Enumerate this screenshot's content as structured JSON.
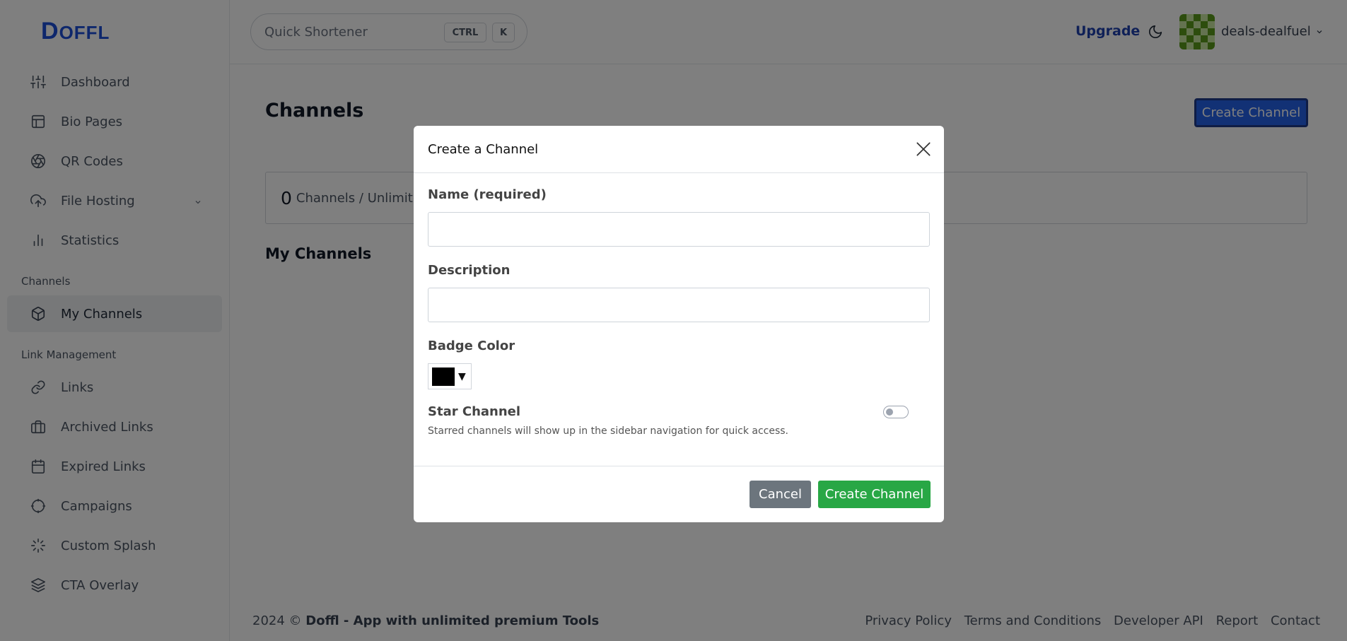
{
  "brand": {
    "logo_text": "OFFL",
    "logo_first": "D"
  },
  "sidebar": {
    "items_top": [
      {
        "label": "Dashboard",
        "icon": "sliders-icon"
      },
      {
        "label": "Bio Pages",
        "icon": "layout-icon"
      },
      {
        "label": "QR Codes",
        "icon": "aperture-icon"
      },
      {
        "label": "File Hosting",
        "icon": "cloud-upload-icon"
      },
      {
        "label": "Statistics",
        "icon": "bar-chart-icon"
      }
    ],
    "channels_section": "Channels",
    "channels_item": "My Channels",
    "link_section": "Link Management",
    "link_items": [
      {
        "label": "Links"
      },
      {
        "label": "Archived Links"
      },
      {
        "label": "Expired Links"
      },
      {
        "label": "Campaigns"
      },
      {
        "label": "Custom Splash"
      },
      {
        "label": "CTA Overlay"
      }
    ]
  },
  "topbar": {
    "search_placeholder": "Quick Shortener",
    "kbd_ctrl": "CTRL",
    "kbd_k": "K",
    "upgrade": "Upgrade",
    "username": "deals-dealfuel"
  },
  "main": {
    "title": "Channels",
    "create_button": "Create Channel",
    "stats_count": "0",
    "stats_text": "Channels / Unlimited",
    "section_title": "My Channels"
  },
  "footer": {
    "year": "2024 ©",
    "brand": "Doffl - App with unlimited premium Tools",
    "links": [
      "Privacy Policy",
      "Terms and Conditions",
      "Developer API",
      "Report",
      "Contact"
    ]
  },
  "modal": {
    "title": "Create a Channel",
    "name_label": "Name (required)",
    "description_label": "Description",
    "badge_color_label": "Badge Color",
    "badge_color_value": "#000000",
    "star_label": "Star Channel",
    "star_help": "Starred channels will show up in the sidebar navigation for quick access.",
    "cancel": "Cancel",
    "create": "Create Channel"
  }
}
